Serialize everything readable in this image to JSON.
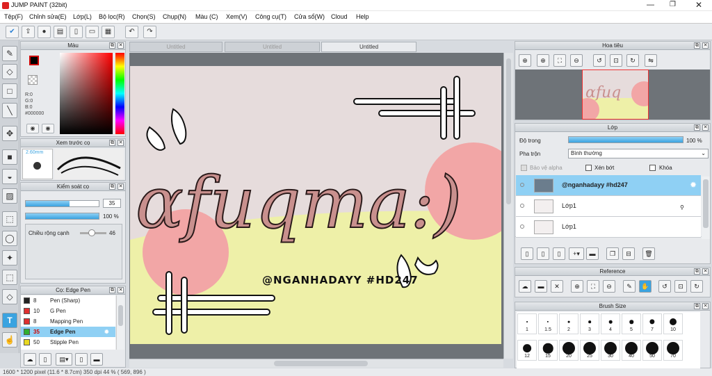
{
  "app": {
    "title": "JUMP PAINT (32bit)"
  },
  "menu": [
    "Tệp(F)",
    "Chỉnh sửa(E)",
    "Lớp(L)",
    "Bộ lọc(R)",
    "Chọn(S)",
    "Chụp(N)",
    "Màu (C)",
    "Xem(V)",
    "Công cụ(T)",
    "Cửa sổ(W)",
    "Cloud",
    "Help"
  ],
  "tabs": [
    "Untitled",
    "Untitled",
    "Untitled"
  ],
  "color_panel": {
    "title": "Màu",
    "r": "R:0",
    "g": "G:0",
    "b": "B:0",
    "hex": "#000000",
    "fg": "#000000",
    "bg": "#ffffff"
  },
  "brush_preview": {
    "title": "Xem trước cọ",
    "size": "2.60mm"
  },
  "brush_control": {
    "title": "Kiểm soát cọ",
    "size_val": "35",
    "opacity_val": "100 %",
    "size_frac": 0.6,
    "opacity_frac": 1.0,
    "edge_label": "Chiều rộng cạnh",
    "edge_val": "46"
  },
  "brush_list": {
    "title": "Cọ: Edge Pen",
    "items": [
      {
        "num": "8",
        "name": "Pen (Sharp)",
        "color": "#222222"
      },
      {
        "num": "10",
        "name": "G Pen",
        "color": "#e03030"
      },
      {
        "num": "8",
        "name": "Mapping Pen",
        "color": "#e03030"
      },
      {
        "num": "35",
        "name": "Edge Pen",
        "color": "#30b030",
        "selected": true
      },
      {
        "num": "50",
        "name": "Stipple Pen",
        "color": "#e8d820"
      }
    ]
  },
  "art": {
    "title": "ɑfuqma:)",
    "handle": "@NGANHADAYY #HD247"
  },
  "navigator": {
    "title": "Hoa tiêu"
  },
  "layers": {
    "title": "Lớp",
    "opacity_label": "Độ trong",
    "opacity_val": "100 %",
    "blend_label": "Pha trộn",
    "blend_val": "Bình thường",
    "alpha_label": "Bảo vệ alpha",
    "clip_label": "Xén bớt",
    "lock_label": "Khóa",
    "items": [
      {
        "name": "@nganhadayy #hd247",
        "selected": true
      },
      {
        "name": "Lớp1"
      },
      {
        "name": "Lớp1"
      }
    ]
  },
  "reference": {
    "title": "Reference"
  },
  "brush_size": {
    "title": "Brush Size",
    "sizes": [
      "1",
      "1.5",
      "2",
      "3",
      "4",
      "5",
      "7",
      "10",
      "12",
      "15",
      "20",
      "25",
      "30",
      "40",
      "50",
      "70"
    ]
  },
  "status": {
    "text": "1600 * 1200 pixel  (11.6 * 8.7cm)  350 dpi  44 %  ( 569, 896 )"
  },
  "colors": {
    "accent": "#3aa3e0",
    "pink": "#f2a6a6",
    "yellow": "#eef0a8",
    "canvas_bg": "#e6dcdc"
  }
}
